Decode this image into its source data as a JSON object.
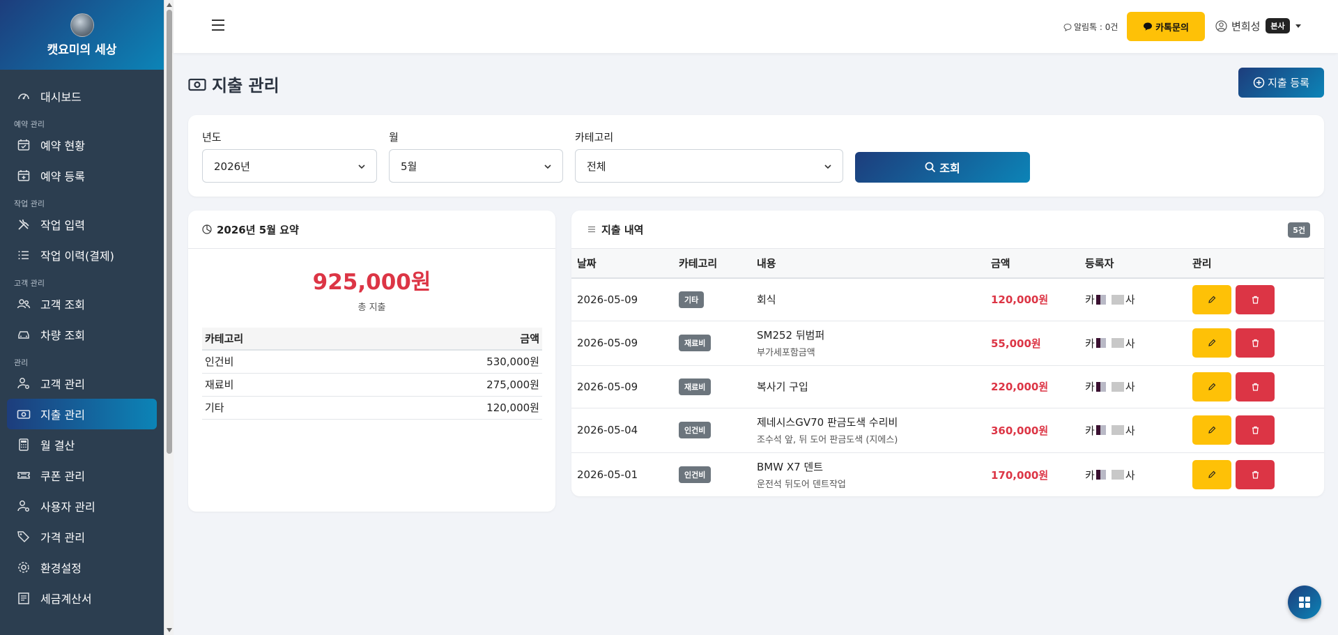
{
  "brand": {
    "name": "캣요미의 세상"
  },
  "sidebar": {
    "items": [
      {
        "label": "대시보드",
        "icon": "gauge-icon"
      },
      {
        "section": "예약 관리"
      },
      {
        "label": "예약 현황",
        "icon": "calendar-check-icon"
      },
      {
        "label": "예약 등록",
        "icon": "calendar-plus-icon"
      },
      {
        "section": "작업 관리"
      },
      {
        "label": "작업 입력",
        "icon": "tools-icon"
      },
      {
        "label": "작업 이력(결제)",
        "icon": "list-icon"
      },
      {
        "section": "고객 관리"
      },
      {
        "label": "고객 조회",
        "icon": "people-icon"
      },
      {
        "label": "차량 조회",
        "icon": "car-icon"
      },
      {
        "section": "관리"
      },
      {
        "label": "고객 관리",
        "icon": "person-gear-icon"
      },
      {
        "label": "지출 관리",
        "icon": "cash-icon",
        "active": true
      },
      {
        "label": "월 결산",
        "icon": "calculator-icon"
      },
      {
        "label": "쿠폰 관리",
        "icon": "ticket-icon"
      },
      {
        "label": "사용자 관리",
        "icon": "person-gear-icon"
      },
      {
        "label": "가격 관리",
        "icon": "tags-icon"
      },
      {
        "label": "환경설정",
        "icon": "gear-icon"
      },
      {
        "label": "세금계산서",
        "icon": "receipt-icon"
      }
    ]
  },
  "topbar": {
    "alert_text": "알림톡 : 0건",
    "kakao_label": "카톡문의",
    "user_name": "변희성",
    "user_badge": "본사"
  },
  "page": {
    "title": "지출 관리",
    "add_label": "지출 등록"
  },
  "filter": {
    "year_label": "년도",
    "year_value": "2026년",
    "month_label": "월",
    "month_value": "5월",
    "category_label": "카테고리",
    "category_value": "전체",
    "search_label": "조회"
  },
  "summary": {
    "title": "2026년 5월 요약",
    "total": "925,000원",
    "total_label": "총 지출",
    "col_category": "카테고리",
    "col_amount": "금액",
    "rows": [
      {
        "category": "인건비",
        "amount": "530,000원"
      },
      {
        "category": "재료비",
        "amount": "275,000원"
      },
      {
        "category": "기타",
        "amount": "120,000원"
      }
    ]
  },
  "list": {
    "title": "지출 내역",
    "count": "5건",
    "columns": [
      "날짜",
      "카테고리",
      "내용",
      "금액",
      "등록자",
      "관리"
    ],
    "rows": [
      {
        "date": "2026-05-09",
        "category": "기타",
        "desc": "회식",
        "sub": "",
        "amount": "120,000원",
        "reg_a": "카",
        "reg_b": "사"
      },
      {
        "date": "2026-05-09",
        "category": "재료비",
        "desc": "SM252 뒤범퍼",
        "sub": "부가세포함금액",
        "amount": "55,000원",
        "reg_a": "카",
        "reg_b": "사"
      },
      {
        "date": "2026-05-09",
        "category": "재료비",
        "desc": "복사기 구입",
        "sub": "",
        "amount": "220,000원",
        "reg_a": "카",
        "reg_b": "사"
      },
      {
        "date": "2026-05-04",
        "category": "인건비",
        "desc": "제네시스GV70 판금도색 수리비",
        "sub": "조수석 앞, 뒤 도어 판금도색 (지에스)",
        "amount": "360,000원",
        "reg_a": "카",
        "reg_b": "사"
      },
      {
        "date": "2026-05-01",
        "category": "인건비",
        "desc": "BMW X7 덴트",
        "sub": "운전석 뒤도어 덴트작업",
        "amount": "170,000원",
        "reg_a": "카",
        "reg_b": "사"
      }
    ]
  },
  "colors": {
    "accent_start": "#1d3d7c",
    "accent_end": "#0c84b7",
    "danger": "#dc3545",
    "warning": "#fec107",
    "sidebar": "#2c3e50"
  }
}
